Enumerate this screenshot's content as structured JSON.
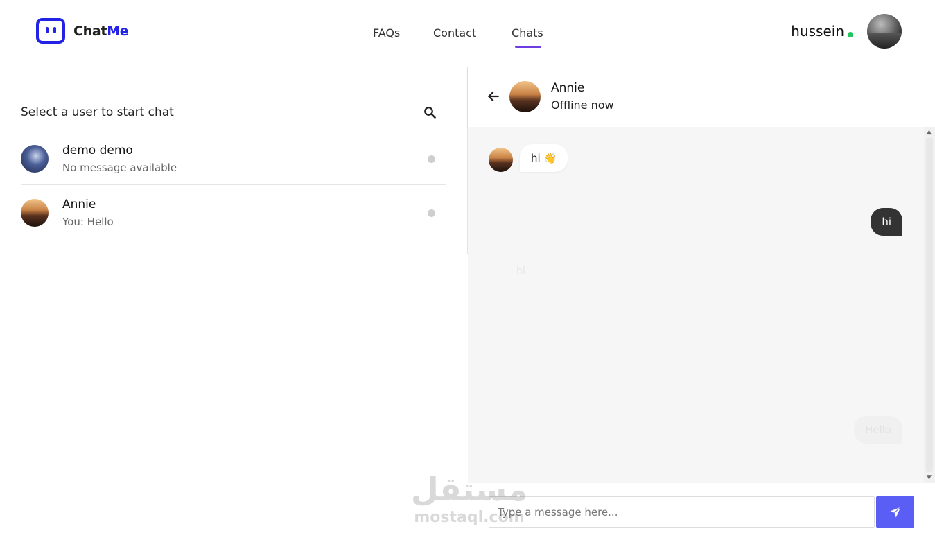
{
  "header": {
    "logo": {
      "text_main": "Chat",
      "text_accent": "Me"
    },
    "nav": {
      "faqs": "FAQs",
      "contact": "Contact",
      "chats": "Chats",
      "active": "Chats"
    },
    "user": {
      "name": "hussein",
      "status_color": "#22c55e"
    }
  },
  "sidebar": {
    "title": "Select a user to start chat",
    "users": [
      {
        "name": "demo demo",
        "last_message": "No message available",
        "status": "offline"
      },
      {
        "name": "Annie",
        "last_message": "You: Hello",
        "status": "offline"
      }
    ]
  },
  "chat": {
    "contact_name": "Annie",
    "contact_status": "Offline now",
    "messages": [
      {
        "direction": "incoming",
        "text": "hi 👋"
      },
      {
        "direction": "outgoing",
        "text": "hi"
      },
      {
        "direction": "incoming",
        "text": "hi"
      },
      {
        "direction": "outgoing",
        "text": "Hello"
      }
    ],
    "input_placeholder": "Type a message here..."
  },
  "watermark": {
    "arabic": "مستقل",
    "latin": "mostaql.com"
  },
  "colors": {
    "brand": "#2323e8",
    "nav_underline": "#6c3de0",
    "send_button": "#5b5ef5",
    "outgoing_bubble": "#333333"
  }
}
